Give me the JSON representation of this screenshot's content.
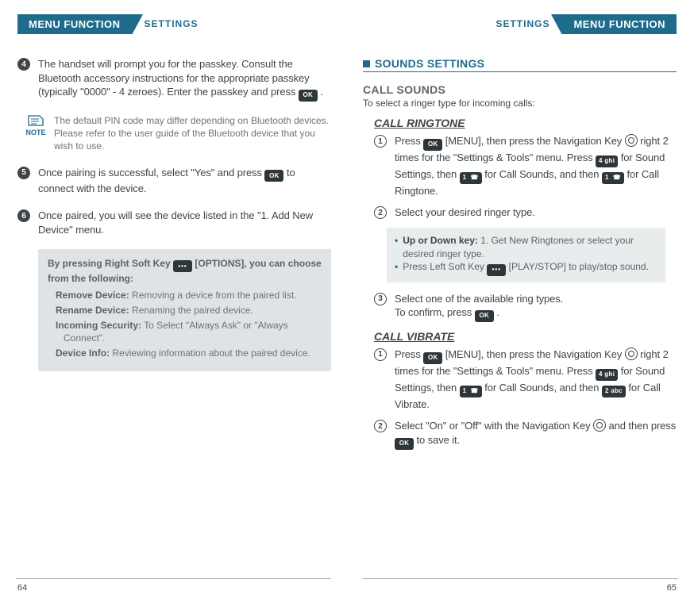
{
  "left": {
    "tab_main": "MENU FUNCTION",
    "tab_sub": "SETTINGS",
    "step4": "The handset will prompt you for the passkey. Consult the Bluetooth accessory instructions for the appropriate passkey (typically \"0000\" - 4 zeroes). Enter the passkey and press ",
    "step4_tail": " .",
    "note_label": "NOTE",
    "note_text": "The default PIN code may differ depending on Bluetooth devices. Please refer to the user guide of the Bluetooth device that you wish to use.",
    "step5_a": "Once pairing is successful, select \"Yes\" and press ",
    "step5_b": " to connect with the device.",
    "step6": "Once paired, you will see the device listed in the \"1. Add New Device\" menu.",
    "box_lead_a": "By pressing Right Soft Key ",
    "box_lead_b": " [OPTIONS], you can choose from the following:",
    "box_items": [
      {
        "t": "Remove Device:",
        "d": " Removing a device from the paired list."
      },
      {
        "t": "Rename Device:",
        "d": " Renaming the paired device."
      },
      {
        "t": "Incoming Security:",
        "d": " To Select \"Always Ask\" or \"Always Connect\"."
      },
      {
        "t": "Device Info:",
        "d": " Reviewing information about the paired device."
      }
    ],
    "page_no": "64"
  },
  "right": {
    "tab_main": "MENU FUNCTION",
    "tab_sub": "SETTINGS",
    "sec_title": "SOUNDS SETTINGS",
    "h2": "CALL SOUNDS",
    "h2_sub": "To select a ringer type for incoming calls:",
    "h3_a": "CALL RINGTONE",
    "r1_a": "Press ",
    "r1_b": " [MENU], then press the Navigation Key ",
    "r1_c": " right 2 times for the \"Settings & Tools\" menu. Press ",
    "r1_d": " for Sound Settings, then ",
    "r1_e": " for Call Sounds, and then ",
    "r1_f": " for Call Ringtone.",
    "r2": "Select your desired ringer type.",
    "kb_up_label": "Up or Down key:",
    "kb_up_text": " 1. Get New Ringtones or select your desired ringer type.",
    "kb_left_a": "Press Left Soft Key ",
    "kb_left_b": " [PLAY/STOP] to play/stop sound.",
    "r3_a": "Select one of the available ring types.",
    "r3_b": "To confirm, press ",
    "r3_c": " .",
    "h3_b": "CALL VIBRATE",
    "v1_a": "Press ",
    "v1_b": " [MENU], then press the Navigation Key ",
    "v1_c": " right 2 times for the \"Settings & Tools\" menu. Press ",
    "v1_d": " for Sound Settings, then ",
    "v1_e": " for Call Sounds, and then ",
    "v1_f": " for Call Vibrate.",
    "v2_a": "Select \"On\" or \"Off\" with the Navigation Key ",
    "v2_b": " and then press ",
    "v2_c": " to save it.",
    "page_no": "65"
  }
}
